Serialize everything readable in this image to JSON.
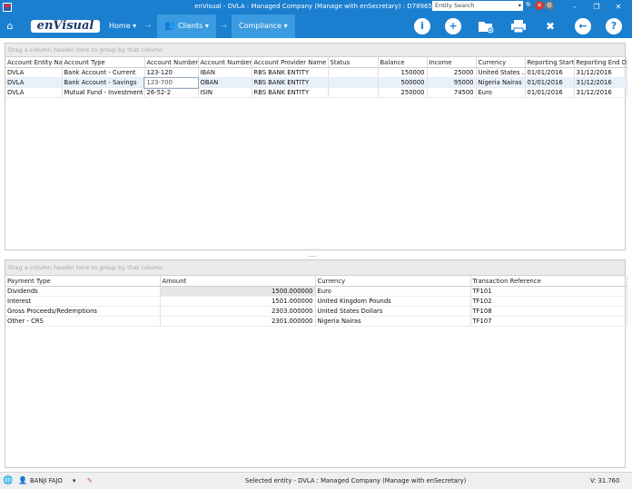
{
  "window": {
    "title": "enVisual - DVLA : Managed Company (Manage with enSecretary) : D78965",
    "search_placeholder": "Entity Search"
  },
  "toolbar": {
    "logo_text": "enVisual",
    "nav": [
      {
        "label": "Home"
      },
      {
        "label": "Clients"
      },
      {
        "label": "Compliance"
      }
    ],
    "tools": [
      "info-icon",
      "add-icon",
      "add-folder-icon",
      "print-icon",
      "tools-icon",
      "back-icon",
      "help-icon"
    ]
  },
  "accounts_grid": {
    "group_hint": "Drag a column header here to group by that column",
    "columns": [
      "Account Entity Nan",
      "Account Type",
      "Account Number",
      "Account Number",
      "Account Provider Name",
      "Status",
      "Balance",
      "Income",
      "Currency",
      "Reporting Start D",
      "Reporting End Da"
    ],
    "rows": [
      [
        "DVLA",
        "Bank Account - Current",
        "123-120",
        "IBAN",
        "RBS BANK ENTITY",
        "",
        "150000",
        "25000",
        "United States ...",
        "01/01/2016",
        "31/12/2016"
      ],
      [
        "DVLA",
        "Bank Account - Savings",
        "123-700",
        "OBAN",
        "RBS BANK ENTITY",
        "",
        "500000",
        "95000",
        "Nigeria Nairas",
        "01/01/2016",
        "31/12/2016"
      ],
      [
        "DVLA",
        "Mutual Fund - Investment",
        "26-52-2",
        "ISIN",
        "RBS BANK ENTITY",
        "",
        "250000",
        "74500",
        "Euro",
        "01/01/2016",
        "31/12/2016"
      ]
    ]
  },
  "splitter_label": "....",
  "payments_grid": {
    "group_hint": "Drag a column header here to group by that column",
    "columns": [
      "Payment Type",
      "Amount",
      "Currency",
      "Transaction Reference"
    ],
    "rows": [
      [
        "Dividends",
        "1500.000000",
        "Euro",
        "TF101"
      ],
      [
        "Interest",
        "1501.000000",
        "United Kingdom Pounds",
        "TF102"
      ],
      [
        "Gross Proceeds/Redemptions",
        "2303.000000",
        "United States Dollars",
        "TF108"
      ],
      [
        "Other - CRS",
        "2301.000000",
        "Nigeria Nairas",
        "TF107"
      ]
    ]
  },
  "status": {
    "user": "BANJI FAJO",
    "selected_entity": "Selected entity - DVLA : Managed Company (Manage with enSecretary)",
    "version": "V: 31.760"
  },
  "colors": {
    "brand_blue": "#1b7fd0",
    "nav_active": "#3a9be0"
  }
}
